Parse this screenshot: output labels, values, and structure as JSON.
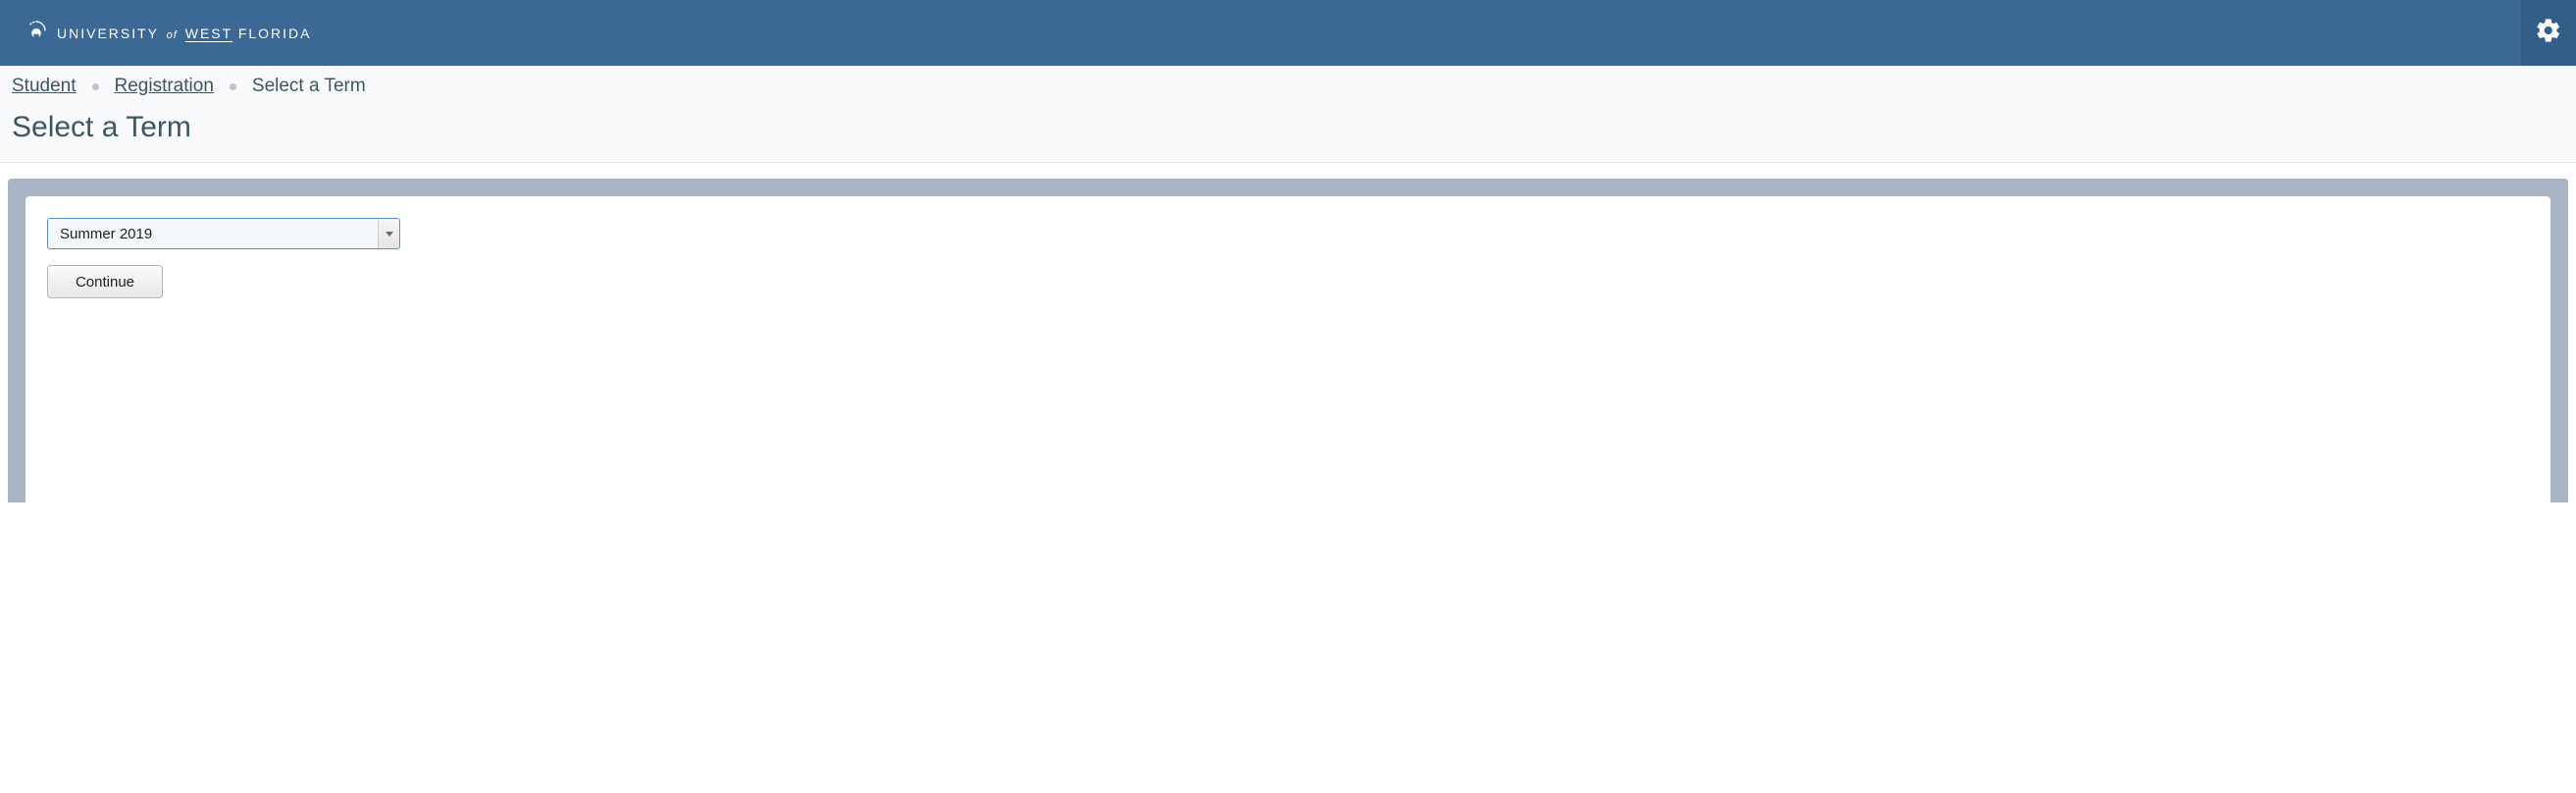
{
  "header": {
    "brand_prefix": "UNIVERSITY",
    "brand_of": "of",
    "brand_west": "WEST",
    "brand_suffix": "FLORIDA"
  },
  "breadcrumb": {
    "items": [
      {
        "label": "Student",
        "link": true
      },
      {
        "label": "Registration",
        "link": true
      },
      {
        "label": "Select a Term",
        "link": false
      }
    ]
  },
  "page": {
    "title": "Select a Term"
  },
  "form": {
    "term_selected": "Summer 2019",
    "continue_label": "Continue"
  }
}
